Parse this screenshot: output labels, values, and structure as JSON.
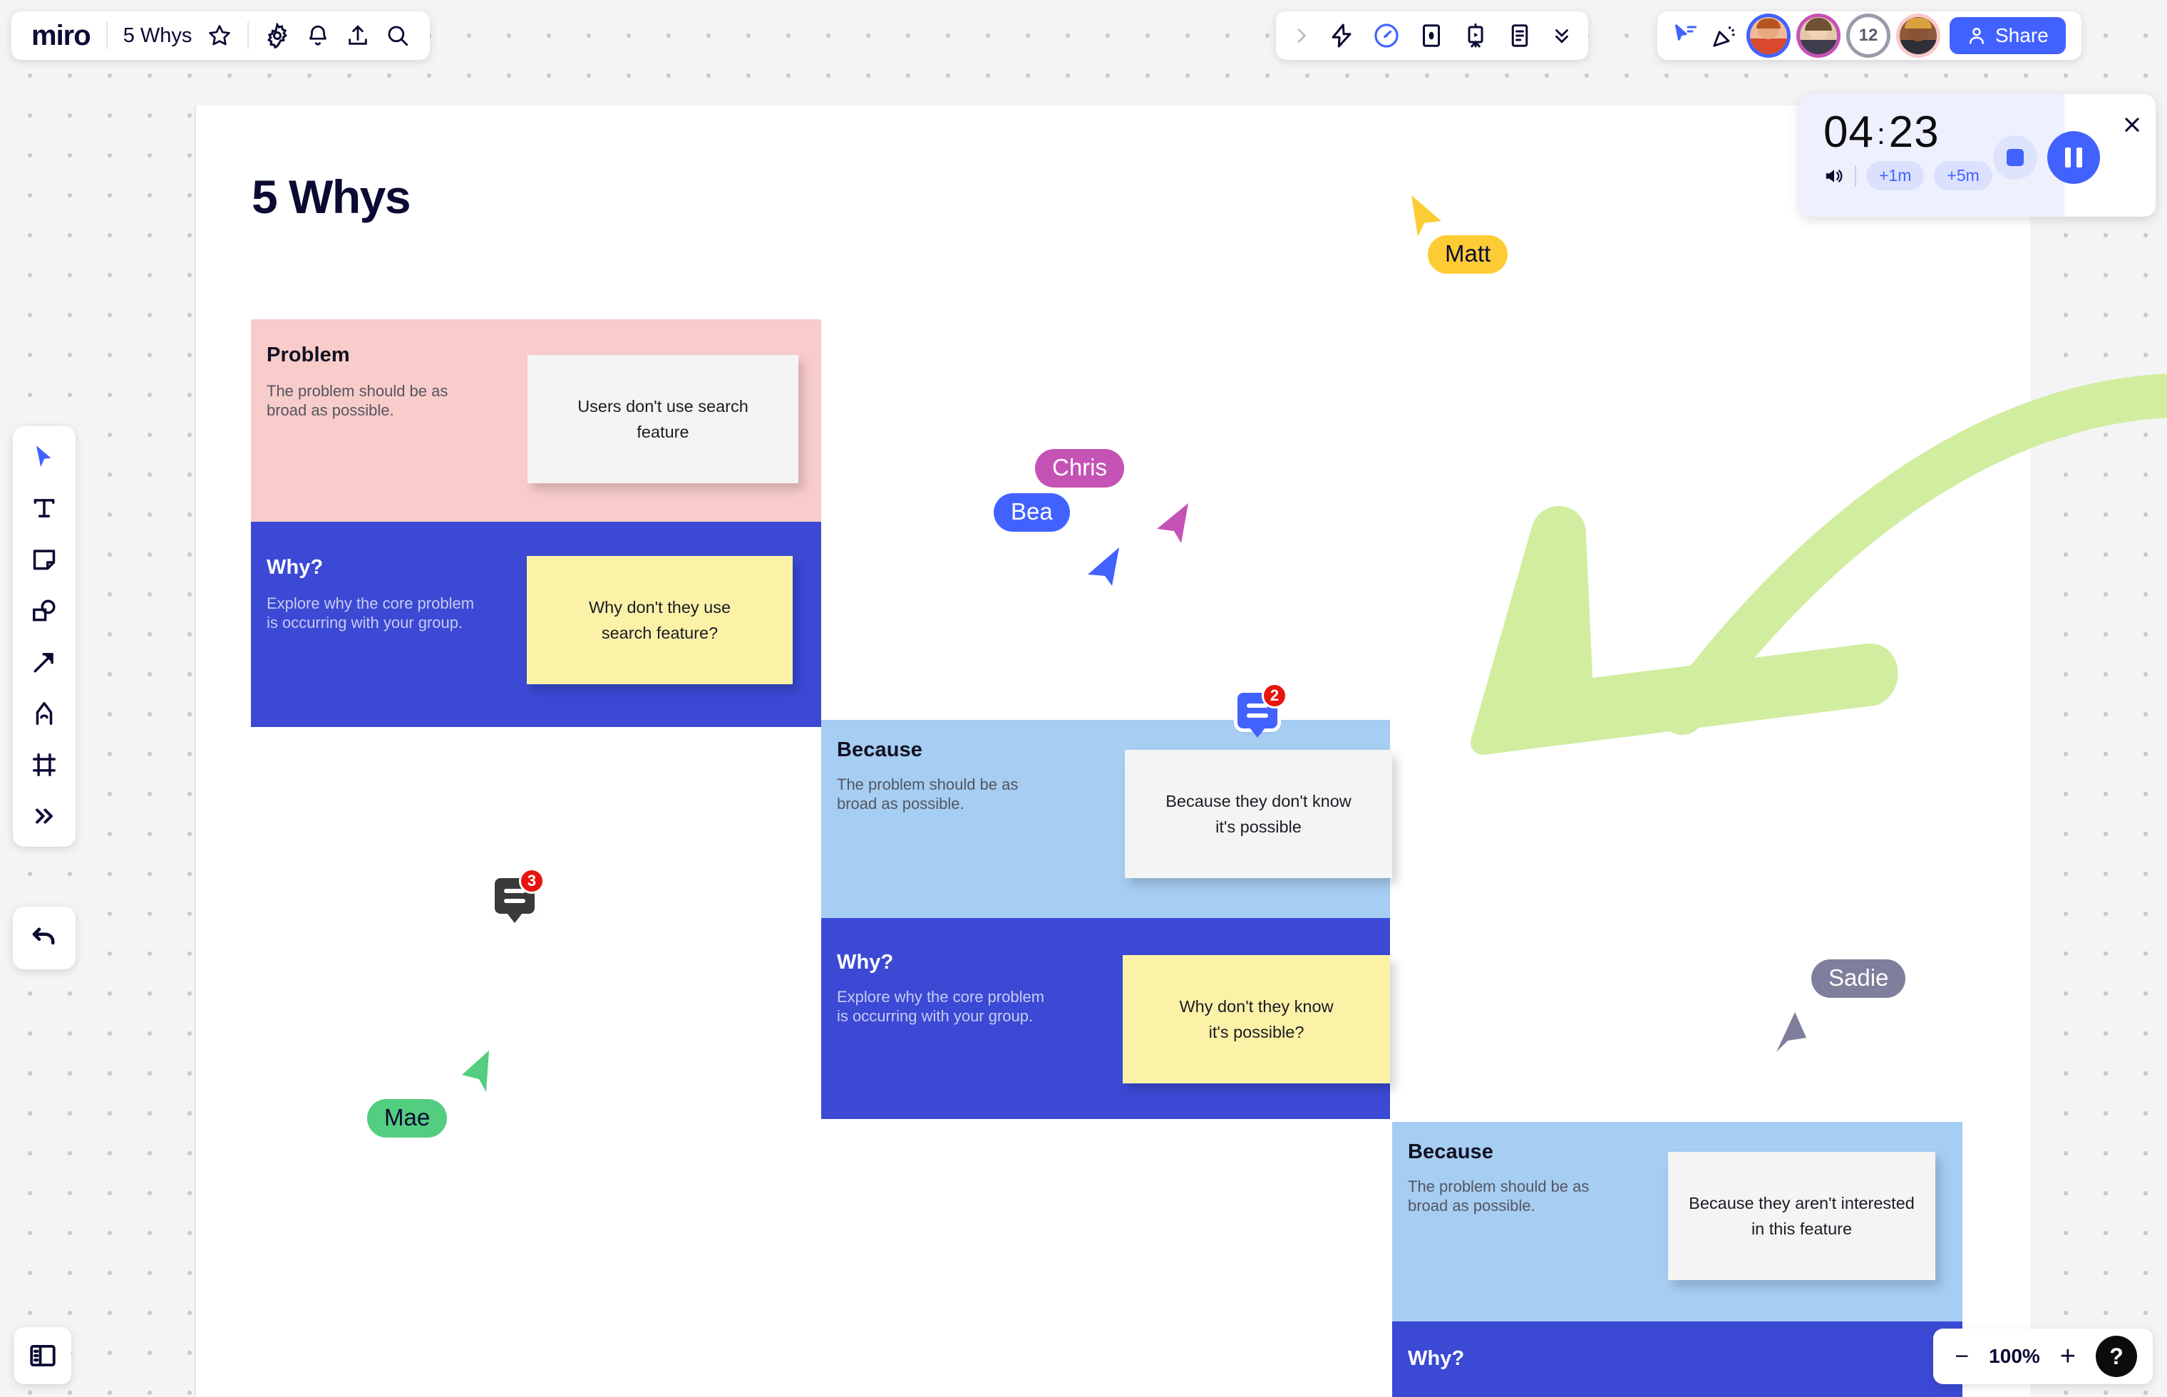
{
  "app": {
    "logo": "miro",
    "board_name": "5 Whys"
  },
  "topbar": {
    "left_icons": [
      "star-icon",
      "gear-icon",
      "bell-icon",
      "upload-icon",
      "search-icon"
    ],
    "mid_icons": [
      "chevron-right-icon",
      "lightning-icon",
      "timer-icon",
      "card-icon",
      "presentation-icon",
      "notes-icon",
      "chevron-double-down-icon"
    ],
    "right_icons": [
      "cursor-share-icon",
      "celebrate-icon"
    ],
    "collaborator_overflow": "12",
    "share_label": "Share"
  },
  "timer": {
    "minutes": "04",
    "separator": ":",
    "seconds": "23",
    "add_one": "+1m",
    "add_five": "+5m",
    "sound_icon": "volume-icon",
    "stop_icon": "stop-icon",
    "pause_icon": "pause-icon",
    "close_icon": "close-icon"
  },
  "board": {
    "title": "5 Whys",
    "blocks": [
      {
        "id": "problem",
        "heading": "Problem",
        "description": "The problem should be as\nbroad as possible.",
        "note": "Users don't use search\nfeature",
        "band": "pink",
        "note_color": "white"
      },
      {
        "id": "why-1",
        "heading": "Why?",
        "description": "Explore why the core problem\nis occurring with your group.",
        "note": "Why don't they use\nsearch feature?",
        "band": "blue",
        "note_color": "yellow"
      },
      {
        "id": "because-1",
        "heading": "Because",
        "description": "The problem should be as\nbroad as possible.",
        "note": "Because they don't know\nit's possible",
        "band": "light-blue",
        "note_color": "white"
      },
      {
        "id": "why-2",
        "heading": "Why?",
        "description": "Explore why the core problem\nis occurring with your group.",
        "note": "Why don't they know\nit's possible?",
        "band": "blue",
        "note_color": "yellow"
      },
      {
        "id": "because-2",
        "heading": "Because",
        "description": "The problem should be as\nbroad as possible.",
        "note": "Because they aren't interested\nin this feature",
        "band": "light-blue",
        "note_color": "white"
      },
      {
        "id": "why-3",
        "heading": "Why?",
        "description": "",
        "note": "",
        "band": "blue",
        "note_color": "none"
      }
    ],
    "cursors": [
      {
        "name": "Matt",
        "color": "#fdcc34",
        "text_color": "#0a0a33"
      },
      {
        "name": "Chris",
        "color": "#c552b5",
        "text_color": "#ffffff"
      },
      {
        "name": "Bea",
        "color": "#4262ff",
        "text_color": "#ffffff"
      },
      {
        "name": "Sadie",
        "color": "#7f7e9c",
        "text_color": "#ffffff"
      },
      {
        "name": "Mae",
        "color": "#53cd7f",
        "text_color": "#0a0a33"
      }
    ],
    "comment_pins": [
      {
        "count": "3",
        "color": "#3a3a3a"
      },
      {
        "count": "2",
        "color": "#4262ff"
      }
    ],
    "annotation": {
      "type": "curved-arrow",
      "color": "#d1eda0"
    }
  },
  "zoom": {
    "minus": "−",
    "level": "100%",
    "plus": "+",
    "help": "?"
  },
  "tools": {
    "items": [
      "select-icon",
      "text-icon",
      "sticky-note-icon",
      "shapes-icon",
      "connector-icon",
      "pen-icon",
      "frame-icon",
      "more-tools-icon"
    ],
    "undo": "undo-icon",
    "panel": "panel-toggle-icon"
  },
  "colors": {
    "accent": "#4262ff",
    "band_pink": "#f8ccca",
    "band_blue": "#3b49d4",
    "band_light_blue": "#a6cdf2",
    "note_yellow": "#fbf2a8",
    "note_white": "#f4f4f4",
    "badge_red": "#e8140f"
  }
}
